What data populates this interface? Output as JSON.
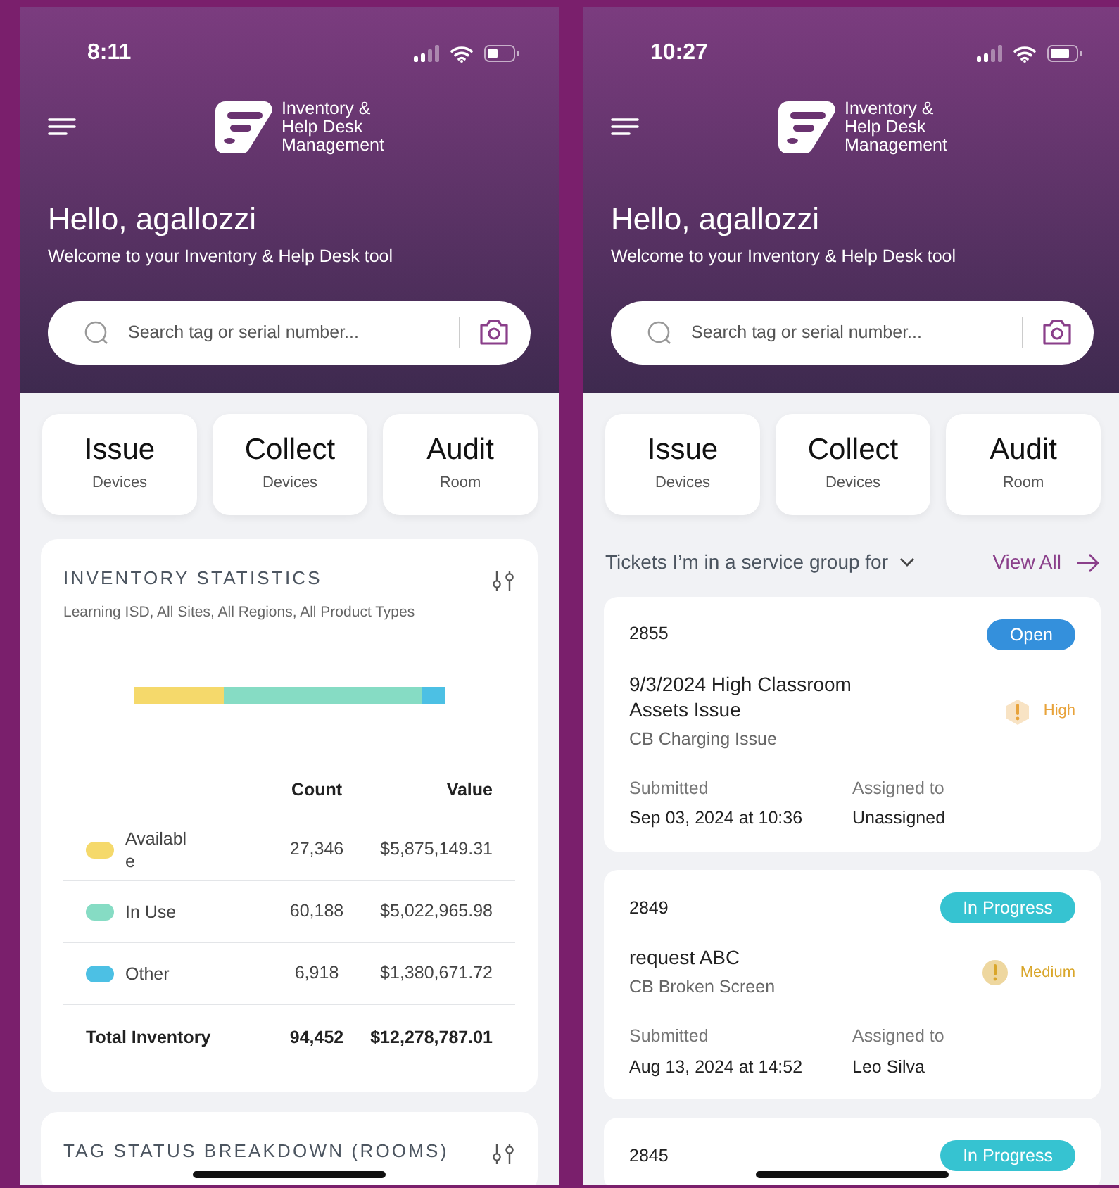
{
  "screens": [
    {
      "status_bar": {
        "time": "8:11"
      },
      "app_name": [
        "Inventory &",
        "Help Desk",
        "Management"
      ],
      "greeting": "Hello, agallozzi",
      "welcome": "Welcome to your Inventory & Help Desk tool",
      "search": {
        "placeholder": "Search tag or serial number..."
      },
      "actions": [
        {
          "title": "Issue",
          "subtitle": "Devices"
        },
        {
          "title": "Collect",
          "subtitle": "Devices"
        },
        {
          "title": "Audit",
          "subtitle": "Room"
        }
      ],
      "content": {
        "kind": "statistics",
        "title": "INVENTORY STATISTICS",
        "filters": "Learning ISD, All Sites, All Regions, All Product Types",
        "columns": [
          "Count",
          "Value"
        ],
        "rows": [
          {
            "label": "Available",
            "color": "#f5d96b",
            "count": "27,346",
            "value": "$5,875,149.31"
          },
          {
            "label": "In Use",
            "color": "#86dcc4",
            "count": "60,188",
            "value": "$5,022,965.98"
          },
          {
            "label": "Other",
            "color": "#4cc0e4",
            "count": "6,918",
            "value": "$1,380,671.72"
          }
        ],
        "total": {
          "label": "Total Inventory",
          "count": "94,452",
          "value": "$12,278,787.01"
        },
        "next_title": "TAG STATUS BREAKDOWN (ROOMS)"
      }
    },
    {
      "status_bar": {
        "time": "10:27"
      },
      "app_name": [
        "Inventory &",
        "Help Desk",
        "Management"
      ],
      "greeting": "Hello, agallozzi",
      "welcome": "Welcome to your Inventory & Help Desk tool",
      "search": {
        "placeholder": "Search tag or serial number..."
      },
      "actions": [
        {
          "title": "Issue",
          "subtitle": "Devices"
        },
        {
          "title": "Collect",
          "subtitle": "Devices"
        },
        {
          "title": "Audit",
          "subtitle": "Room"
        }
      ],
      "content": {
        "kind": "tickets",
        "filter": "Tickets I’m in a service group for",
        "view_all": "View All",
        "tickets": [
          {
            "id": "2855",
            "status": {
              "text": "Open",
              "color": "#3490dc"
            },
            "title": "9/3/2024 High Classroom Assets Issue",
            "category": "CB Charging Issue",
            "priority": {
              "text": "High",
              "color": "#e8a33b",
              "kind": "hexagon"
            },
            "submitted_label": "Submitted",
            "submitted": "Sep 03, 2024 at 10:36",
            "assigned_label": "Assigned to",
            "assigned": "Unassigned"
          },
          {
            "id": "2849",
            "status": {
              "text": "In Progress",
              "color": "#36c3d1"
            },
            "title": "request ABC",
            "category": "CB Broken Screen",
            "priority": {
              "text": "Medium",
              "color": "#d9a62a",
              "kind": "circle"
            },
            "submitted_label": "Submitted",
            "submitted": "Aug 13, 2024 at 14:52",
            "assigned_label": "Assigned to",
            "assigned": "Leo Silva"
          },
          {
            "id": "2845",
            "status": {
              "text": "In Progress",
              "color": "#36c3d1"
            }
          }
        ]
      }
    }
  ]
}
